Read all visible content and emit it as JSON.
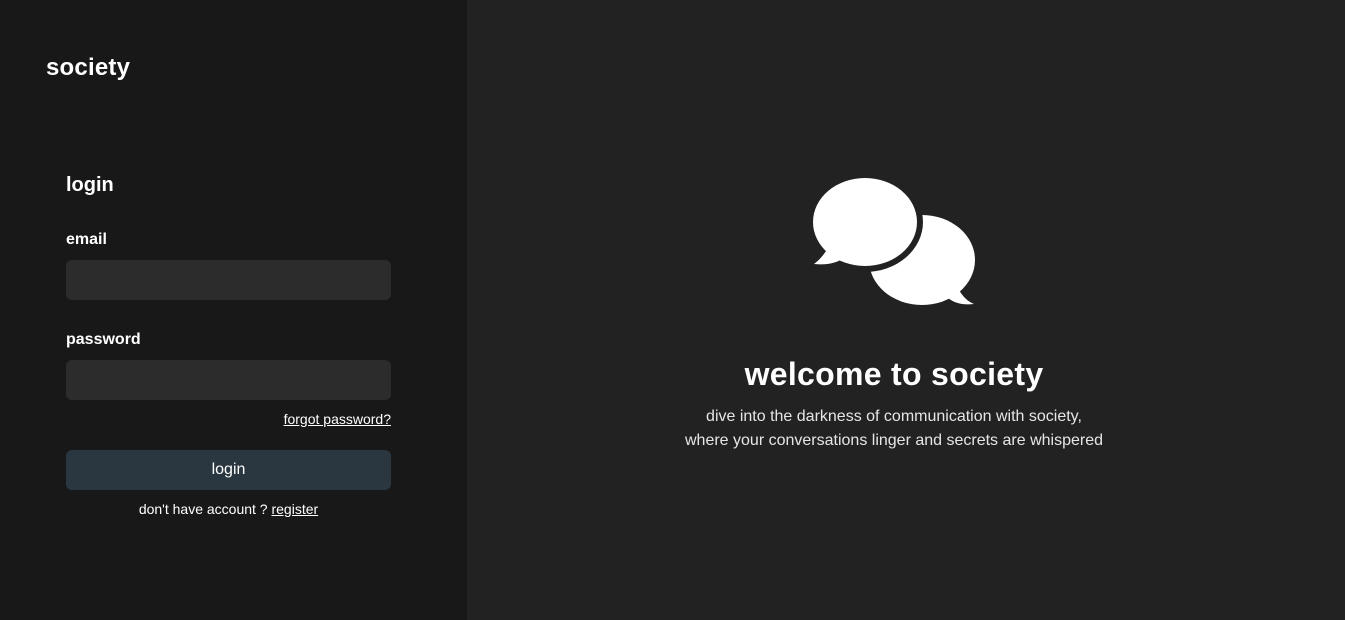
{
  "brand": {
    "name": "society"
  },
  "login_form": {
    "title": "login",
    "email_label": "email",
    "email_value": "",
    "password_label": "password",
    "password_value": "",
    "forgot_link": "forgot password?",
    "submit_label": "login",
    "register_prompt": "don't have account ?",
    "register_link": "register"
  },
  "hero": {
    "icon": "chat-bubbles-icon",
    "title": "welcome to society",
    "subtitle_line1": "dive into the darkness of communication with society,",
    "subtitle_line2": "where your conversations linger and secrets are whispered"
  },
  "colors": {
    "left_panel_bg": "#181818",
    "right_panel_bg": "#222222",
    "input_bg": "#2c2c2c",
    "button_bg": "#2a3741",
    "text": "#ffffff"
  }
}
